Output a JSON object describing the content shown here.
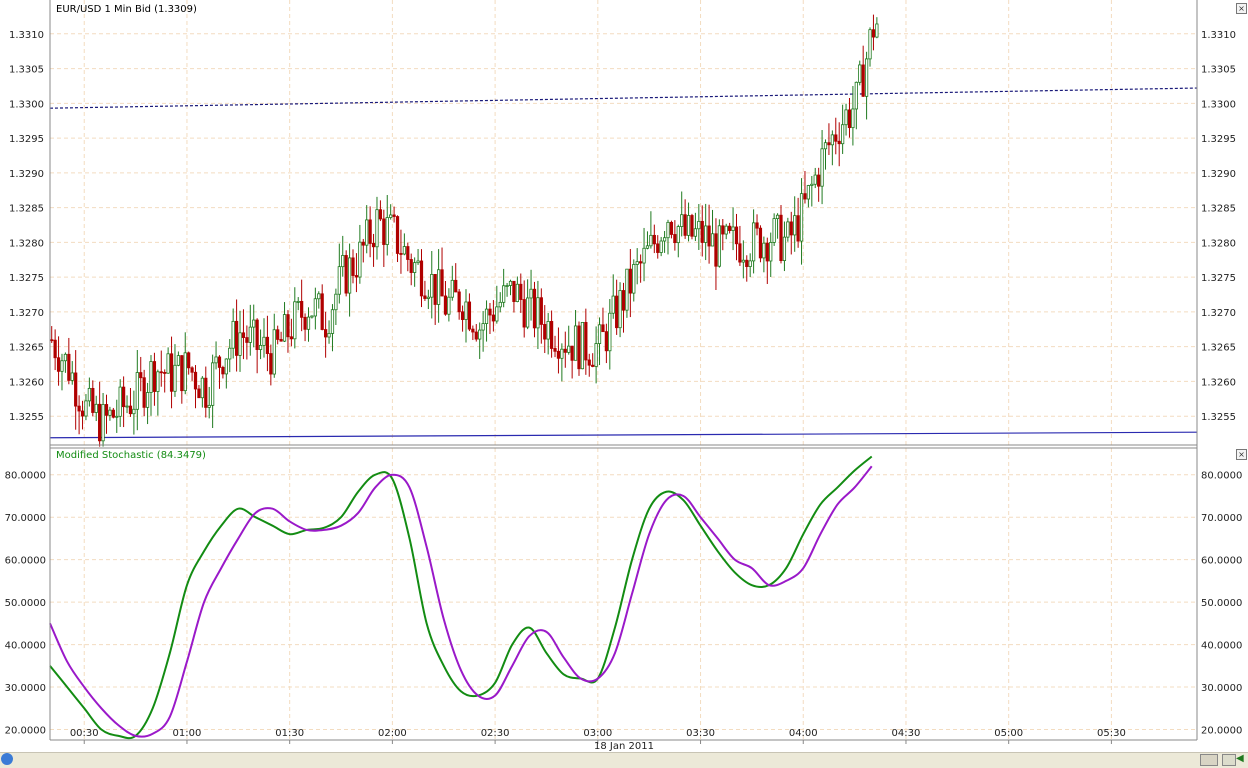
{
  "chart_data": [
    {
      "type": "candlestick",
      "title": "EUR/USD 1 Min Bid (1.3309)",
      "ylim": [
        1.3251,
        1.3314
      ],
      "yticks": [
        "1.3255",
        "1.3260",
        "1.3265",
        "1.3270",
        "1.3275",
        "1.3280",
        "1.3285",
        "1.3290",
        "1.3295",
        "1.3300",
        "1.3305",
        "1.3310"
      ],
      "up_color": "#1f7a1f",
      "down_color": "#b00000",
      "grid": true,
      "trendlines": [
        {
          "style": "dashed",
          "color": "#1a1a7a",
          "from": [
            "00:20",
            1.32993
          ],
          "to": [
            "05:55",
            1.33022
          ]
        },
        {
          "style": "solid",
          "color": "#2a2ab0",
          "from": [
            "00:20",
            1.32519
          ],
          "to": [
            "05:55",
            1.32527
          ]
        }
      ],
      "price_path": [
        [
          "00:20",
          1.3266
        ],
        [
          "00:25",
          1.3262
        ],
        [
          "00:30",
          1.3256
        ],
        [
          "00:35",
          1.3254
        ],
        [
          "00:40",
          1.3256
        ],
        [
          "00:45",
          1.3258
        ],
        [
          "00:50",
          1.3262
        ],
        [
          "00:55",
          1.3261
        ],
        [
          "01:00",
          1.3262
        ],
        [
          "01:05",
          1.3259
        ],
        [
          "01:10",
          1.3264
        ],
        [
          "01:15",
          1.3267
        ],
        [
          "01:20",
          1.3265
        ],
        [
          "01:25",
          1.3264
        ],
        [
          "01:30",
          1.3268
        ],
        [
          "01:35",
          1.3271
        ],
        [
          "01:40",
          1.3269
        ],
        [
          "01:45",
          1.3275
        ],
        [
          "01:50",
          1.3278
        ],
        [
          "01:55",
          1.3283
        ],
        [
          "02:00",
          1.3281
        ],
        [
          "02:05",
          1.3277
        ],
        [
          "02:10",
          1.3275
        ],
        [
          "02:15",
          1.3271
        ],
        [
          "02:20",
          1.3272
        ],
        [
          "02:25",
          1.3268
        ],
        [
          "02:30",
          1.3271
        ],
        [
          "02:35",
          1.3273
        ],
        [
          "02:40",
          1.327
        ],
        [
          "02:45",
          1.3268
        ],
        [
          "02:50",
          1.3266
        ],
        [
          "02:55",
          1.3265
        ],
        [
          "03:00",
          1.3265
        ],
        [
          "03:05",
          1.327
        ],
        [
          "03:10",
          1.3275
        ],
        [
          "03:15",
          1.3279
        ],
        [
          "03:20",
          1.3284
        ],
        [
          "03:25",
          1.3281
        ],
        [
          "03:30",
          1.3281
        ],
        [
          "03:35",
          1.3279
        ],
        [
          "03:40",
          1.328
        ],
        [
          "03:45",
          1.328
        ],
        [
          "03:50",
          1.3281
        ],
        [
          "03:55",
          1.328
        ],
        [
          "04:00",
          1.3285
        ],
        [
          "04:05",
          1.3292
        ],
        [
          "04:10",
          1.3297
        ],
        [
          "04:15",
          1.33
        ],
        [
          "04:20",
          1.3311
        ],
        [
          "04:22",
          1.3312
        ]
      ]
    },
    {
      "type": "line",
      "title": "Modified Stochastic (84.3479)",
      "ylim": [
        18,
        83
      ],
      "yticks": [
        "20.0000",
        "30.0000",
        "40.0000",
        "50.0000",
        "60.0000",
        "70.0000",
        "80.0000"
      ],
      "grid": true,
      "series": [
        {
          "color": "#138c13",
          "points": [
            [
              "00:20",
              35
            ],
            [
              "00:25",
              30
            ],
            [
              "00:30",
              25
            ],
            [
              "00:35",
              20
            ],
            [
              "00:40",
              18.5
            ],
            [
              "00:45",
              18.5
            ],
            [
              "00:50",
              25
            ],
            [
              "00:55",
              38
            ],
            [
              "01:00",
              54
            ],
            [
              "01:05",
              62
            ],
            [
              "01:10",
              68
            ],
            [
              "01:15",
              72
            ],
            [
              "01:20",
              70
            ],
            [
              "01:25",
              68
            ],
            [
              "01:30",
              66
            ],
            [
              "01:35",
              67
            ],
            [
              "01:40",
              67.5
            ],
            [
              "01:45",
              70
            ],
            [
              "01:50",
              76
            ],
            [
              "01:55",
              80
            ],
            [
              "02:00",
              79
            ],
            [
              "02:05",
              65
            ],
            [
              "02:10",
              45
            ],
            [
              "02:15",
              35
            ],
            [
              "02:20",
              29
            ],
            [
              "02:25",
              28
            ],
            [
              "02:30",
              31
            ],
            [
              "02:35",
              40
            ],
            [
              "02:40",
              44
            ],
            [
              "02:45",
              38
            ],
            [
              "02:50",
              33
            ],
            [
              "02:55",
              32
            ],
            [
              "03:00",
              32
            ],
            [
              "03:05",
              44
            ],
            [
              "03:10",
              60
            ],
            [
              "03:15",
              72
            ],
            [
              "03:20",
              76
            ],
            [
              "03:25",
              74
            ],
            [
              "03:30",
              68
            ],
            [
              "03:35",
              62
            ],
            [
              "03:40",
              57
            ],
            [
              "03:45",
              54
            ],
            [
              "03:50",
              54
            ],
            [
              "03:55",
              58
            ],
            [
              "04:00",
              66
            ],
            [
              "04:05",
              73
            ],
            [
              "04:10",
              77
            ],
            [
              "04:15",
              81
            ],
            [
              "04:20",
              84.3
            ]
          ]
        },
        {
          "color": "#9a19c9",
          "points": [
            [
              "00:20",
              45
            ],
            [
              "00:25",
              36
            ],
            [
              "00:30",
              30
            ],
            [
              "00:35",
              25
            ],
            [
              "00:40",
              21
            ],
            [
              "00:45",
              18.5
            ],
            [
              "00:50",
              19
            ],
            [
              "00:55",
              23
            ],
            [
              "01:00",
              36
            ],
            [
              "01:05",
              50
            ],
            [
              "01:10",
              58
            ],
            [
              "01:15",
              65
            ],
            [
              "01:20",
              71
            ],
            [
              "01:25",
              72
            ],
            [
              "01:30",
              69
            ],
            [
              "01:35",
              67
            ],
            [
              "01:40",
              67
            ],
            [
              "01:45",
              68
            ],
            [
              "01:50",
              71
            ],
            [
              "01:55",
              77
            ],
            [
              "02:00",
              80
            ],
            [
              "02:05",
              77
            ],
            [
              "02:10",
              63
            ],
            [
              "02:15",
              46
            ],
            [
              "02:20",
              34
            ],
            [
              "02:25",
              28
            ],
            [
              "02:30",
              28
            ],
            [
              "02:35",
              35
            ],
            [
              "02:40",
              42
            ],
            [
              "02:45",
              43
            ],
            [
              "02:50",
              37
            ],
            [
              "02:55",
              32
            ],
            [
              "03:00",
              32
            ],
            [
              "03:05",
              38
            ],
            [
              "03:10",
              52
            ],
            [
              "03:15",
              66
            ],
            [
              "03:20",
              74
            ],
            [
              "03:25",
              75
            ],
            [
              "03:30",
              70
            ],
            [
              "03:35",
              65
            ],
            [
              "03:40",
              60
            ],
            [
              "03:45",
              58
            ],
            [
              "03:50",
              54
            ],
            [
              "03:55",
              55
            ],
            [
              "04:00",
              58
            ],
            [
              "04:05",
              66
            ],
            [
              "04:10",
              73
            ],
            [
              "04:15",
              77
            ],
            [
              "04:20",
              82
            ]
          ]
        }
      ]
    }
  ],
  "x_axis": {
    "ticks": [
      "00:30",
      "01:00",
      "01:30",
      "02:00",
      "02:30",
      "03:00",
      "03:30",
      "04:00",
      "04:30",
      "05:00",
      "05:30"
    ],
    "date_label": "18 Jan 2011",
    "range": [
      "00:20",
      "05:55"
    ]
  },
  "ui": {
    "close_icon": "close-icon",
    "scroll_right_icon": "arrow-right-icon"
  }
}
